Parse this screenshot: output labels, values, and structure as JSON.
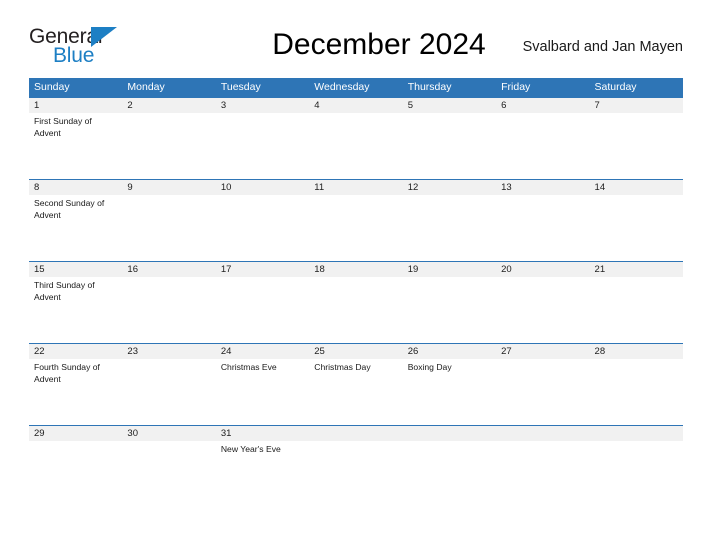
{
  "brand": {
    "name_part1": "General",
    "name_part2": "Blue",
    "flag_icon": "flag-triangle-icon",
    "accent_color": "#1d7fc4"
  },
  "header": {
    "month_title": "December 2024",
    "region": "Svalbard and Jan Mayen"
  },
  "theme": {
    "header_blue": "#2e75b6",
    "row_band_gray": "#f1f1f1",
    "text_dark": "#1a1a1a"
  },
  "calendar": {
    "day_headers": [
      "Sunday",
      "Monday",
      "Tuesday",
      "Wednesday",
      "Thursday",
      "Friday",
      "Saturday"
    ],
    "weeks": [
      {
        "days": [
          {
            "number": "1",
            "events": [
              "First Sunday of Advent"
            ]
          },
          {
            "number": "2",
            "events": []
          },
          {
            "number": "3",
            "events": []
          },
          {
            "number": "4",
            "events": []
          },
          {
            "number": "5",
            "events": []
          },
          {
            "number": "6",
            "events": []
          },
          {
            "number": "7",
            "events": []
          }
        ]
      },
      {
        "days": [
          {
            "number": "8",
            "events": [
              "Second Sunday of Advent"
            ]
          },
          {
            "number": "9",
            "events": []
          },
          {
            "number": "10",
            "events": []
          },
          {
            "number": "11",
            "events": []
          },
          {
            "number": "12",
            "events": []
          },
          {
            "number": "13",
            "events": []
          },
          {
            "number": "14",
            "events": []
          }
        ]
      },
      {
        "days": [
          {
            "number": "15",
            "events": [
              "Third Sunday of Advent"
            ]
          },
          {
            "number": "16",
            "events": []
          },
          {
            "number": "17",
            "events": []
          },
          {
            "number": "18",
            "events": []
          },
          {
            "number": "19",
            "events": []
          },
          {
            "number": "20",
            "events": []
          },
          {
            "number": "21",
            "events": []
          }
        ]
      },
      {
        "days": [
          {
            "number": "22",
            "events": [
              "Fourth Sunday of Advent"
            ]
          },
          {
            "number": "23",
            "events": []
          },
          {
            "number": "24",
            "events": [
              "Christmas Eve"
            ]
          },
          {
            "number": "25",
            "events": [
              "Christmas Day"
            ]
          },
          {
            "number": "26",
            "events": [
              "Boxing Day"
            ]
          },
          {
            "number": "27",
            "events": []
          },
          {
            "number": "28",
            "events": []
          }
        ]
      },
      {
        "days": [
          {
            "number": "29",
            "events": []
          },
          {
            "number": "30",
            "events": []
          },
          {
            "number": "31",
            "events": [
              "New Year's Eve"
            ]
          },
          {
            "number": "",
            "events": []
          },
          {
            "number": "",
            "events": []
          },
          {
            "number": "",
            "events": []
          },
          {
            "number": "",
            "events": []
          }
        ]
      }
    ]
  }
}
